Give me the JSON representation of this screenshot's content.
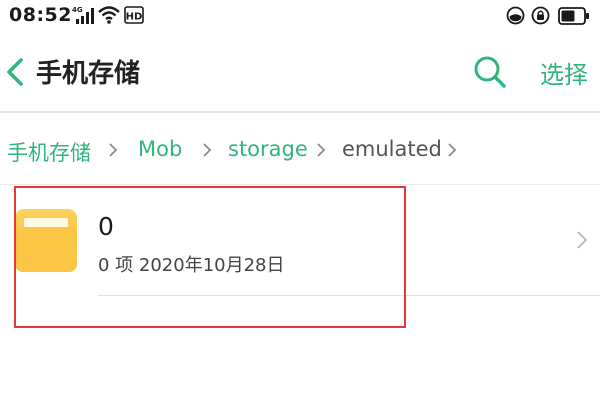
{
  "status_bar": {
    "time": "08:52",
    "network_type": "4G",
    "hd_label": "HD",
    "icons": [
      "signal-icon",
      "wifi-icon",
      "hd-icon",
      "data-saver-icon",
      "privacy-lock-icon",
      "battery-icon"
    ]
  },
  "header": {
    "title": "手机存储",
    "select_label": "选择"
  },
  "breadcrumb": [
    {
      "label": "手机存储"
    },
    {
      "label": "Mob"
    },
    {
      "label": "storage"
    },
    {
      "label": "emulated"
    }
  ],
  "files": [
    {
      "name": "0",
      "meta": "0 项  2020年10月28日"
    }
  ],
  "colors": {
    "accent": "#2fb57d",
    "folder": "#fbc546",
    "highlight": "#e8363b"
  }
}
